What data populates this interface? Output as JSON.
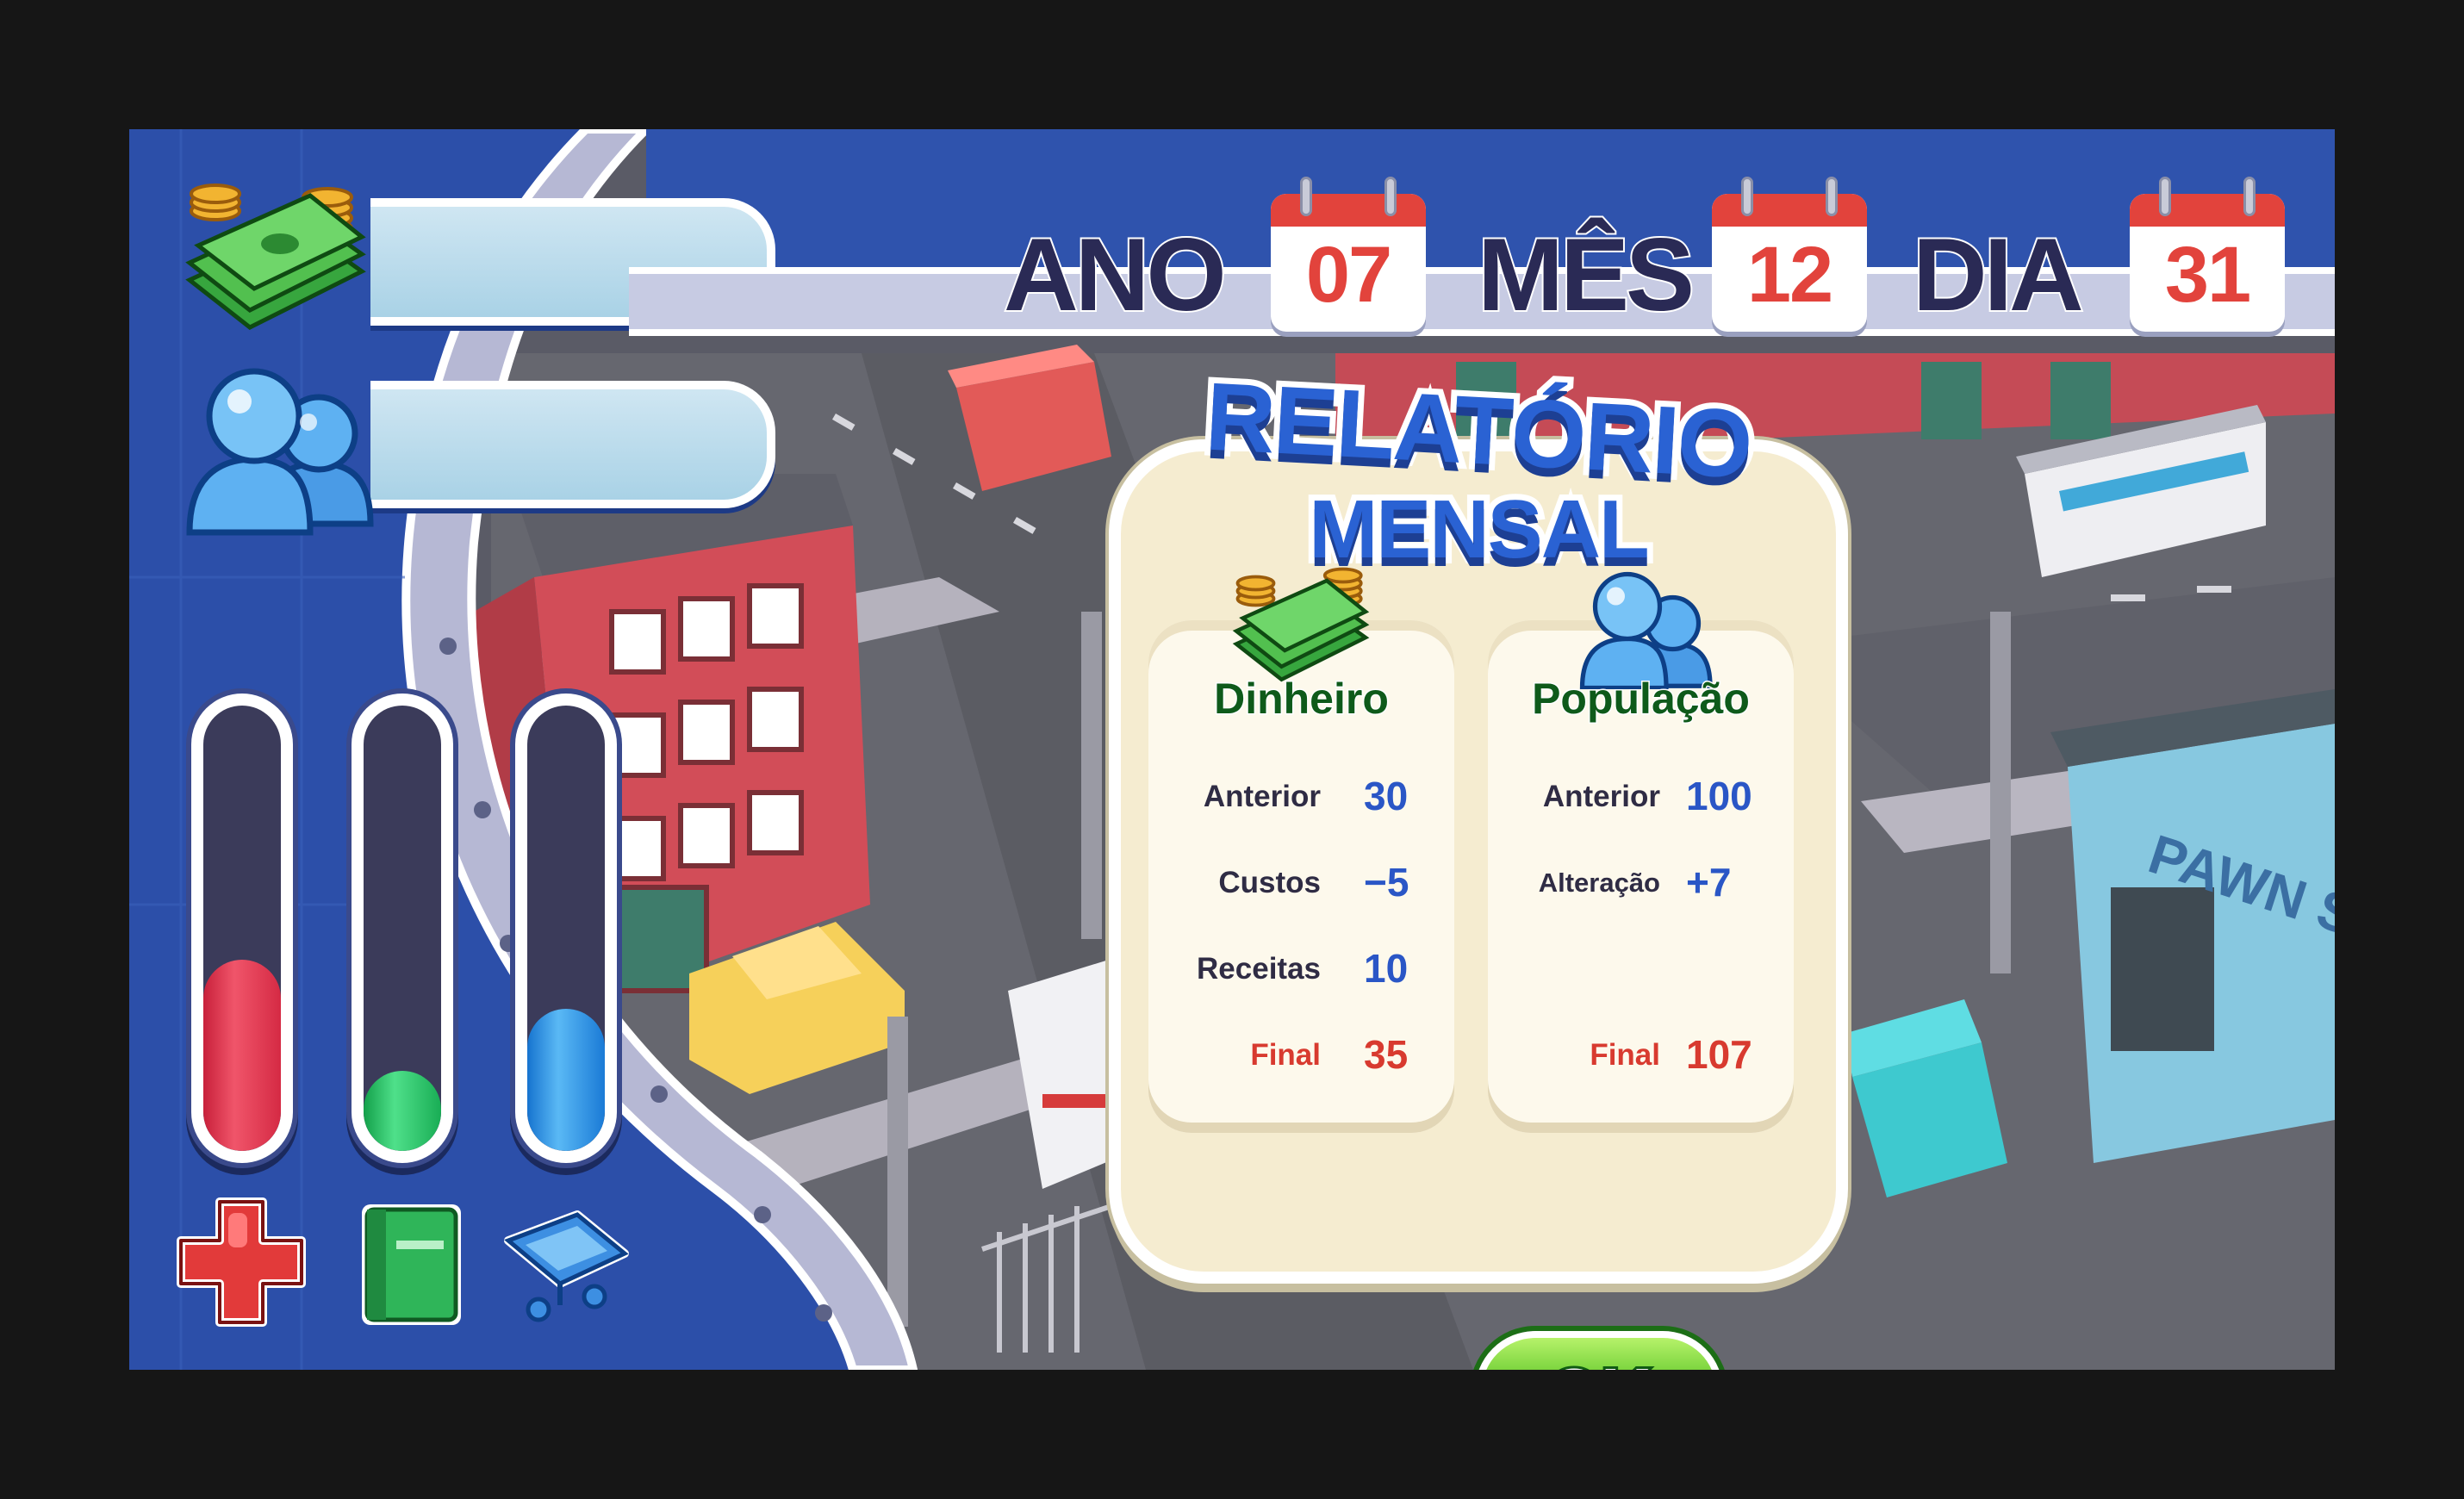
{
  "hud": {
    "money_value": "",
    "population_value": "",
    "meters": [
      {
        "name": "health",
        "level": 0.43,
        "color": "#e23a52",
        "icon": "red-cross-icon"
      },
      {
        "name": "education",
        "level": 0.18,
        "color": "#2ecf6a",
        "icon": "book-icon"
      },
      {
        "name": "shopping",
        "level": 0.32,
        "color": "#3fa0ee",
        "icon": "shopping-cart-icon"
      }
    ]
  },
  "date": {
    "year_label": "ANO",
    "year_value": "07",
    "month_label": "MÊS",
    "month_value": "12",
    "day_label": "DIA",
    "day_value": "31"
  },
  "report": {
    "title_line_1": "RELATÓRIO",
    "title_line_2": "MENSAL",
    "money": {
      "title": "Dinheiro",
      "icon": "money-stack-icon",
      "rows": [
        {
          "label": "Anterior",
          "value": "30"
        },
        {
          "label": "Custos",
          "value": "−5"
        },
        {
          "label": "Receitas",
          "value": "10"
        },
        {
          "label": "Final",
          "value": "35"
        }
      ]
    },
    "population": {
      "title": "População",
      "icon": "people-icon",
      "rows": [
        {
          "label": "Anterior",
          "value": "100"
        },
        {
          "label": "Alteração",
          "value": "+7"
        },
        {
          "label": "Final",
          "value": "107"
        }
      ]
    },
    "ok_label": "OK"
  },
  "colors": {
    "frame_blue": "#2b4da8",
    "title_blue": "#2a62d3",
    "final_red": "#d83a2f",
    "value_blue": "#2a56c6",
    "ok_green": "#57c223"
  }
}
